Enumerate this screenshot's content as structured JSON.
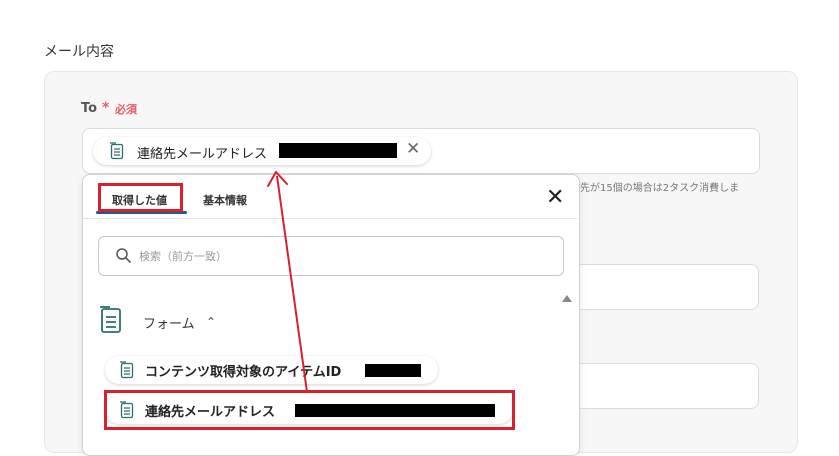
{
  "section": {
    "title": "メール内容"
  },
  "to_field": {
    "label": "To",
    "required_mark": "*",
    "required_text": "必須",
    "token": {
      "label": "連絡先メールアドレス",
      "close_glyph": "✕",
      "icon": "document-list-icon"
    }
  },
  "helper_text": "先が15個の場合は2タスク消費しま",
  "dropdown": {
    "tabs": [
      {
        "label": "取得した値",
        "active": true
      },
      {
        "label": "基本情報",
        "active": false
      }
    ],
    "close_glyph": "✕",
    "search": {
      "placeholder": "検索（前方一致）",
      "value": ""
    },
    "group": {
      "label": "フォーム",
      "chevron": "⌃",
      "expanded": true
    },
    "items": [
      {
        "label": "コンテンツ取得対象のアイテムID"
      },
      {
        "label": "連絡先メールアドレス"
      }
    ]
  },
  "colors": {
    "highlight": "#d9202f",
    "required": "#e35d6a",
    "tab_underline": "#1a5e8a",
    "card_bg": "#f7f7f8"
  }
}
